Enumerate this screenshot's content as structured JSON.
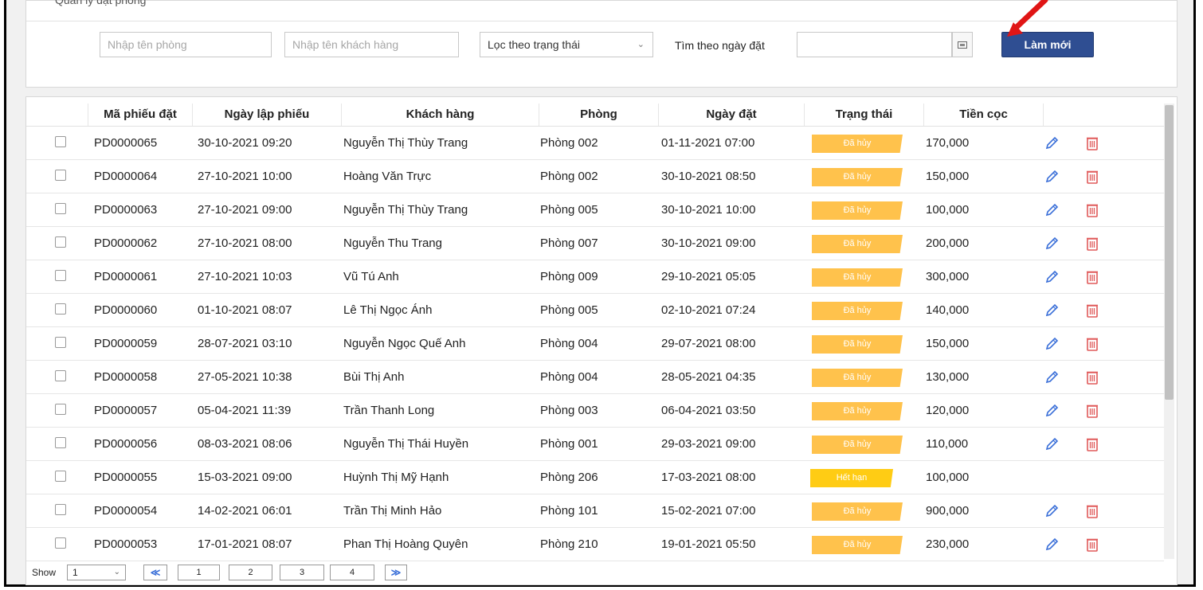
{
  "panel": {
    "title": "Quản lý đặt phòng"
  },
  "filters": {
    "room_placeholder": "Nhập tên phòng",
    "customer_placeholder": "Nhập tên khách hàng",
    "status_select": "Lọc theo trạng thái",
    "date_label": "Tìm theo ngày đặt",
    "refresh_label": "Làm mới"
  },
  "table": {
    "columns": [
      "Mã phiếu đặt",
      "Ngày lập phiếu",
      "Khách hàng",
      "Phòng",
      "Ngày đặt",
      "Trạng thái",
      "Tiền cọc"
    ],
    "rows": [
      {
        "code": "PD0000065",
        "created": "30-10-2021 09:20",
        "customer": "Nguyễn Thị Thùy Trang",
        "room": "Phòng 002",
        "booked": "01-11-2021 07:00",
        "status": "Đã hủy",
        "deposit": "170,000"
      },
      {
        "code": "PD0000064",
        "created": "27-10-2021 10:00",
        "customer": "Hoàng Văn Trực",
        "room": "Phòng 002",
        "booked": "30-10-2021 08:50",
        "status": "Đã hủy",
        "deposit": "150,000"
      },
      {
        "code": "PD0000063",
        "created": "27-10-2021 09:00",
        "customer": "Nguyễn Thị Thùy Trang",
        "room": "Phòng 005",
        "booked": "30-10-2021 10:00",
        "status": "Đã hủy",
        "deposit": "100,000"
      },
      {
        "code": "PD0000062",
        "created": "27-10-2021 08:00",
        "customer": "Nguyễn Thu Trang",
        "room": "Phòng 007",
        "booked": "30-10-2021 09:00",
        "status": "Đã hủy",
        "deposit": "200,000"
      },
      {
        "code": "PD0000061",
        "created": "27-10-2021 10:03",
        "customer": "Vũ Tú Anh",
        "room": "Phòng 009",
        "booked": "29-10-2021 05:05",
        "status": "Đã hủy",
        "deposit": "300,000"
      },
      {
        "code": "PD0000060",
        "created": "01-10-2021 08:07",
        "customer": "Lê Thị Ngọc Ánh",
        "room": "Phòng 005",
        "booked": "02-10-2021 07:24",
        "status": "Đã hủy",
        "deposit": "140,000"
      },
      {
        "code": "PD0000059",
        "created": "28-07-2021 03:10",
        "customer": "Nguyễn Ngọc Quế Anh",
        "room": "Phòng 004",
        "booked": "29-07-2021 08:00",
        "status": "Đã hủy",
        "deposit": "150,000"
      },
      {
        "code": "PD0000058",
        "created": "27-05-2021 10:38",
        "customer": "Bùi Thị Anh",
        "room": "Phòng 004",
        "booked": "28-05-2021 04:35",
        "status": "Đã hủy",
        "deposit": "130,000"
      },
      {
        "code": "PD0000057",
        "created": "05-04-2021 11:39",
        "customer": "Trần Thanh Long",
        "room": "Phòng 003",
        "booked": "06-04-2021 03:50",
        "status": "Đã hủy",
        "deposit": "120,000"
      },
      {
        "code": "PD0000056",
        "created": "08-03-2021 08:06",
        "customer": "Nguyễn Thị Thái Huyền",
        "room": "Phòng 001",
        "booked": "29-03-2021 09:00",
        "status": "Đã hủy",
        "deposit": "110,000"
      },
      {
        "code": "PD0000055",
        "created": "15-03-2021 09:00",
        "customer": "Huỳnh Thị Mỹ Hạnh",
        "room": "Phòng 206",
        "booked": "17-03-2021 08:00",
        "status": "Hết hạn",
        "deposit": "100,000"
      },
      {
        "code": "PD0000054",
        "created": "14-02-2021 06:01",
        "customer": "Trần Thị Minh Hảo",
        "room": "Phòng 101",
        "booked": "15-02-2021 07:00",
        "status": "Đã hủy",
        "deposit": "900,000"
      },
      {
        "code": "PD0000053",
        "created": "17-01-2021 08:07",
        "customer": "Phan Thị Hoàng Quyên",
        "room": "Phòng 210",
        "booked": "19-01-2021 05:50",
        "status": "Đã hủy",
        "deposit": "230,000"
      }
    ]
  },
  "pager": {
    "show_label": "Show",
    "show_value": "1",
    "prev": "≪",
    "pages": [
      "1",
      "2",
      "3",
      "4"
    ],
    "next": "≫"
  },
  "colors": {
    "cancelled": "#ffc24c",
    "expired": "#ffcc14",
    "primary": "#2f4e92",
    "delete": "#e05a5a",
    "edit": "#3a6fd8"
  },
  "icons": {
    "edit": "pencil-icon",
    "delete": "trash-icon",
    "calendar": "calendar-icon",
    "annotation": "red-arrow-icon"
  }
}
